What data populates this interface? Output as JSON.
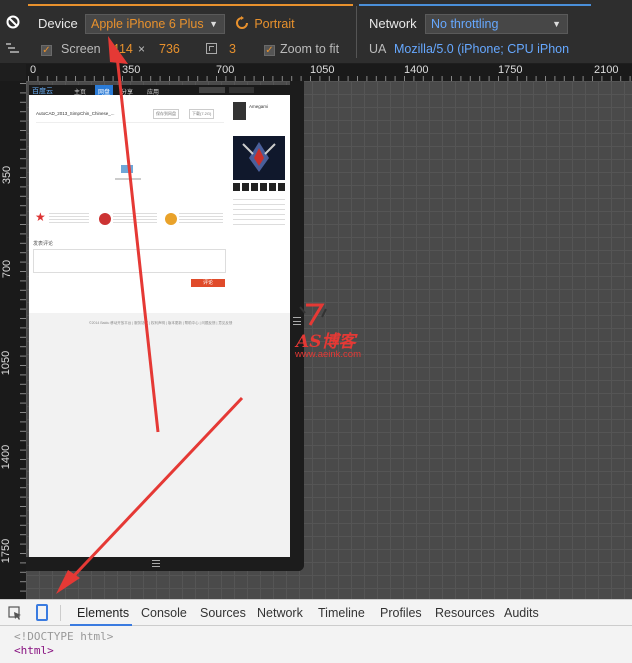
{
  "toolbar": {
    "device_label": "Device",
    "device_value": "Apple iPhone 6 Plus",
    "orientation": "Portrait",
    "screen_label": "Screen",
    "screen_width": "414",
    "screen_x": "×",
    "screen_height": "736",
    "dpr": "3",
    "zoom_label": "Zoom to fit",
    "network_label": "Network",
    "network_value": "No throttling",
    "ua_label": "UA",
    "ua_value": "Mozilla/5.0 (iPhone; CPU iPhon..."
  },
  "ruler_top": [
    "0",
    "350",
    "700",
    "1050",
    "1400",
    "1750",
    "2100"
  ],
  "ruler_left": [
    "350",
    "700",
    "1050",
    "1400",
    "1750"
  ],
  "site": {
    "nav": [
      "百度云",
      "主页",
      "网盘",
      "分享",
      "应用"
    ],
    "filename": "AutoCAD_2013_SimpChin_Chinese_...",
    "btn_save": "保存到网盘",
    "btn_download": "下载(7.2G)",
    "user": "Amegami",
    "comment": "发表评论",
    "submit": "评论",
    "footer": "©2014 Baidu 移动开放平台 | 服务协议 | 权利声明 | 版本更新 | 帮助中心 | 问题反馈 | 意见反馈"
  },
  "watermark": {
    "cn": "AS博客",
    "url": "www.aeink.com"
  },
  "devtools": {
    "tabs": [
      "Elements",
      "Console",
      "Sources",
      "Network",
      "Timeline",
      "Profiles",
      "Resources",
      "Audits"
    ],
    "code": [
      "<!DOCTYPE html>",
      "<html>"
    ]
  },
  "colors": {
    "accent_orange": "#e8912d",
    "accent_blue": "#66a8ff",
    "arrow_red": "#e53935"
  }
}
